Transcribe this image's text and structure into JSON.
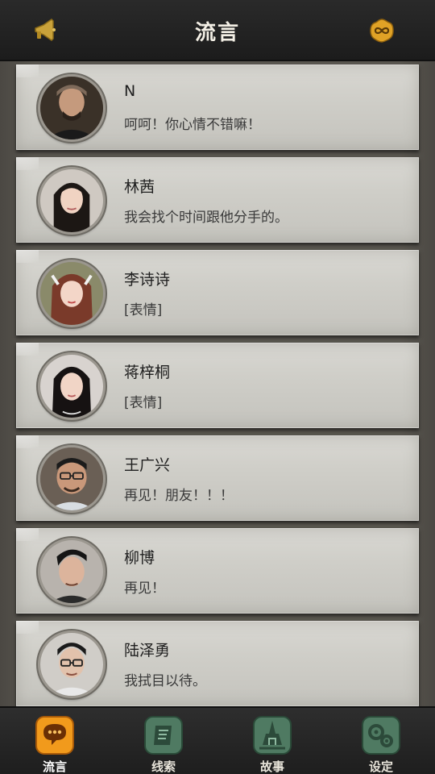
{
  "header": {
    "title": "流言",
    "left_icon": "megaphone-icon",
    "right_icon": "infinity-coin-icon"
  },
  "messages": [
    {
      "name": "N",
      "text": "呵呵！你心情不错嘛！"
    },
    {
      "name": "林茜",
      "text": "我会找个时间跟他分手的。"
    },
    {
      "name": "李诗诗",
      "text": "[表情]"
    },
    {
      "name": "蒋梓桐",
      "text": "[表情]"
    },
    {
      "name": "王广兴",
      "text": "再见！朋友！！！"
    },
    {
      "name": "柳博",
      "text": "再见！"
    },
    {
      "name": "陆泽勇",
      "text": "我拭目以待。"
    }
  ],
  "nav": [
    {
      "label": "流言",
      "icon": "chat-bubble-icon",
      "active": true
    },
    {
      "label": "线索",
      "icon": "scroll-icon",
      "active": false
    },
    {
      "label": "故事",
      "icon": "temple-icon",
      "active": false
    },
    {
      "label": "设定",
      "icon": "gears-icon",
      "active": false
    }
  ],
  "colors": {
    "header_bg": "#1f1f1f",
    "card_bg": "#d2d1cb",
    "active_nav": "#f19a1c",
    "inactive_nav": "#4f7a62"
  }
}
